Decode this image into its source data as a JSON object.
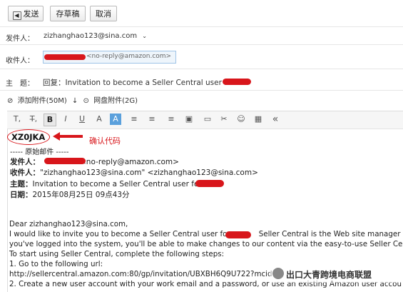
{
  "toolbar": {
    "send_label": "发送",
    "draft_label": "存草稿",
    "cancel_label": "取消"
  },
  "sender": {
    "label": "发件人：",
    "value": "zizhanghao123@sina.com"
  },
  "recipient": {
    "label": "收件人：",
    "value": "<no-reply@amazon.com>"
  },
  "subject": {
    "label": "主　题：",
    "value": "回复：Invitation to become a Seller Central user for"
  },
  "attachments": {
    "attach_label": "添加附件(50M)",
    "arrow": "↓",
    "netdisk_label": "网盘附件(2G)"
  },
  "editor_toolbar": {
    "items": [
      "T,",
      "T̶,",
      "B",
      "I",
      "U",
      "A",
      "A",
      "≡",
      "≡",
      "≡",
      "▣",
      "▭",
      "✂",
      "☺",
      "▦",
      "«"
    ]
  },
  "annotation": {
    "code": "XZ0JKA",
    "note": "确认代码",
    "color": "#d8161b"
  },
  "quoted": {
    "divider": "----- 原始邮件 -----",
    "from_label": "发件人：",
    "from_value": "<no-reply@amazon.com>",
    "to_label": "收件人：",
    "to_value": "\"zizhanghao123@sina.com\" <zizhanghao123@sina.com>",
    "subject_label": "主题：",
    "subject_value": "Invitation to become a Seller Central user for",
    "date_label": "日期：",
    "date_value": "2015年08月25日 09点43分"
  },
  "body": {
    "greeting": "Dear zizhanghao123@sina.com,",
    "line1a": "I would like to invite you to become a Seller Central user for",
    "line1b": "Seller Central is the Web site manager",
    "line2": "you've logged into the system, you'll be able to make changes to our content via the easy-to-use Seller Cent",
    "line3": "To start using Seller Central, complete the following steps:",
    "line4": "1. Go to the following url:",
    "line5": "http://sellercentral.amazon.com:80/gp/invitation/UBXBH6Q9U722?mcid=",
    "line6": "2. Create a new user account with your work email and a password, or use an existing Amazon user accou"
  },
  "watermark": {
    "text": "出口大青跨境电商联盟"
  }
}
